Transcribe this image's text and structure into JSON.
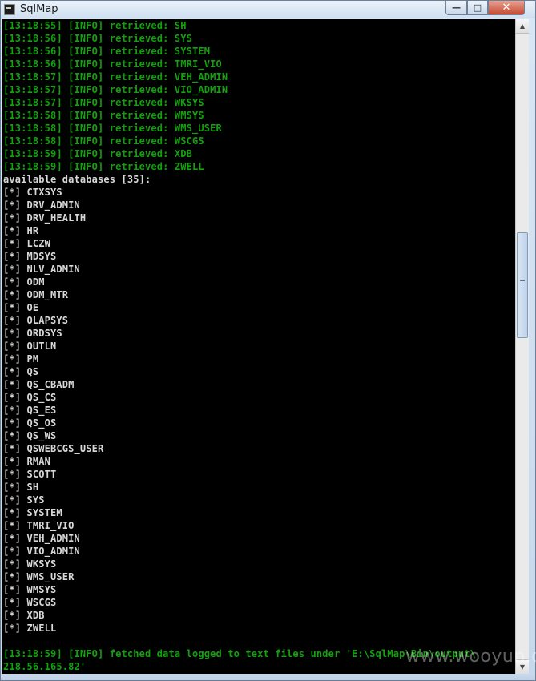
{
  "window": {
    "title": "SqlMap",
    "controls": {
      "minimize": "—",
      "maximize": "□",
      "close": "✕"
    },
    "icon": "console-app-icon"
  },
  "console": {
    "retrieved_lines": [
      {
        "time": "[13:18:55]",
        "level": "[INFO]",
        "text": "retrieved: SH"
      },
      {
        "time": "[13:18:56]",
        "level": "[INFO]",
        "text": "retrieved: SYS"
      },
      {
        "time": "[13:18:56]",
        "level": "[INFO]",
        "text": "retrieved: SYSTEM"
      },
      {
        "time": "[13:18:56]",
        "level": "[INFO]",
        "text": "retrieved: TMRI_VIO"
      },
      {
        "time": "[13:18:57]",
        "level": "[INFO]",
        "text": "retrieved: VEH_ADMIN"
      },
      {
        "time": "[13:18:57]",
        "level": "[INFO]",
        "text": "retrieved: VIO_ADMIN"
      },
      {
        "time": "[13:18:57]",
        "level": "[INFO]",
        "text": "retrieved: WKSYS"
      },
      {
        "time": "[13:18:58]",
        "level": "[INFO]",
        "text": "retrieved: WMSYS"
      },
      {
        "time": "[13:18:58]",
        "level": "[INFO]",
        "text": "retrieved: WMS_USER"
      },
      {
        "time": "[13:18:58]",
        "level": "[INFO]",
        "text": "retrieved: WSCGS"
      },
      {
        "time": "[13:18:59]",
        "level": "[INFO]",
        "text": "retrieved: XDB"
      },
      {
        "time": "[13:18:59]",
        "level": "[INFO]",
        "text": "retrieved: ZWELL"
      }
    ],
    "available_header": "available databases [35]:",
    "db_prefix": "[*]",
    "databases": [
      "CTXSYS",
      "DRV_ADMIN",
      "DRV_HEALTH",
      "HR",
      "LCZW",
      "MDSYS",
      "NLV_ADMIN",
      "ODM",
      "ODM_MTR",
      "OE",
      "OLAPSYS",
      "ORDSYS",
      "OUTLN",
      "PM",
      "QS",
      "QS_CBADM",
      "QS_CS",
      "QS_ES",
      "QS_OS",
      "QS_WS",
      "QSWEBCGS_USER",
      "RMAN",
      "SCOTT",
      "SH",
      "SYS",
      "SYSTEM",
      "TMRI_VIO",
      "VEH_ADMIN",
      "VIO_ADMIN",
      "WKSYS",
      "WMS_USER",
      "WMSYS",
      "WSCGS",
      "XDB",
      "ZWELL"
    ],
    "footer_line_1": "[13:18:59] [INFO] fetched data logged to text files under 'E:\\SqlMap\\Bin\\output\\",
    "footer_line_2": "218.56.165.82'",
    "colors": {
      "info": "#13a10e",
      "plain": "#d8d8d8",
      "background": "#000000"
    }
  },
  "scrollbar": {
    "up_arrow": "▲",
    "down_arrow": "▼",
    "position": 0.35
  },
  "watermark": "www.wooyun.org"
}
